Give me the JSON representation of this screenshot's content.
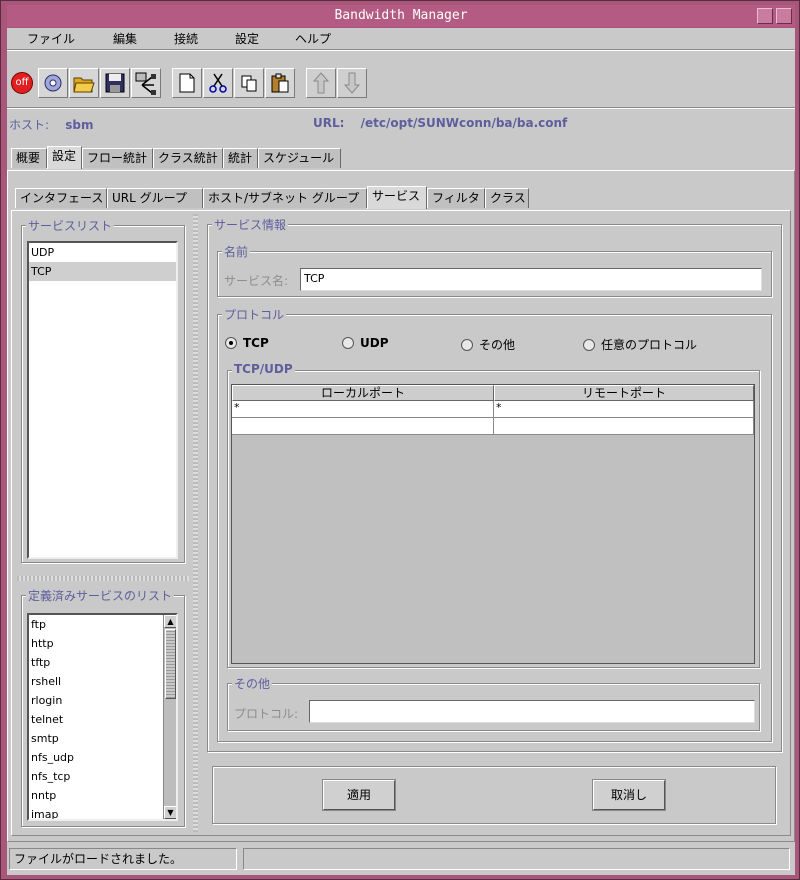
{
  "window": {
    "title": "Bandwidth Manager",
    "buttons": [
      "▫",
      "□"
    ]
  },
  "menubar": {
    "items": [
      "ファイル",
      "編集",
      "接続",
      "設定",
      "ヘルプ"
    ]
  },
  "toolbar": {
    "off_label": "off",
    "icons": [
      "power-off-icon",
      "connect-icon",
      "open-folder-icon",
      "save-icon",
      "deploy-icon",
      "new-file-icon",
      "cut-icon",
      "copy-icon",
      "paste-icon",
      "arrow-up-icon",
      "arrow-down-icon"
    ]
  },
  "info": {
    "host_label": "ホスト:",
    "host_value": "sbm",
    "url_label": "URL:",
    "url_value": "/etc/opt/SUNWconn/ba/ba.conf"
  },
  "tabs_top": [
    "概要",
    "設定",
    "フロー統計",
    "クラス統計",
    "統計",
    "スケジュール"
  ],
  "tabs_config": [
    "インタフェース",
    "URL グループ",
    "ホスト/サブネット グループ",
    "サービス",
    "フィルタ",
    "クラス"
  ],
  "left": {
    "service_list_title": "サービスリスト",
    "service_list": [
      "UDP",
      "TCP"
    ],
    "predefined_title": "定義済みサービスのリスト",
    "predefined": [
      "ftp",
      "http",
      "tftp",
      "rshell",
      "rlogin",
      "telnet",
      "smtp",
      "nfs_udp",
      "nfs_tcp",
      "nntp",
      "imap"
    ]
  },
  "service_info": {
    "title": "サービス情報",
    "name_group": "名前",
    "name_label": "サービス名:",
    "name_value": "TCP",
    "protocol_group": "プロトコル",
    "radios": [
      "TCP",
      "UDP",
      "その他",
      "任意のプロトコル"
    ],
    "selected_radio": "TCP",
    "tcpudp_group": "TCP/UDP",
    "table_headers": [
      "ローカルポート",
      "リモートポート"
    ],
    "table_rows": [
      [
        "*",
        "*"
      ],
      [
        "",
        ""
      ]
    ],
    "other_group": "その他",
    "protocol_label": "プロトコル:",
    "protocol_value": ""
  },
  "actions": {
    "apply": "適用",
    "cancel": "取消し"
  },
  "status": {
    "message": "ファイルがロードされました。",
    "secondary": ""
  }
}
